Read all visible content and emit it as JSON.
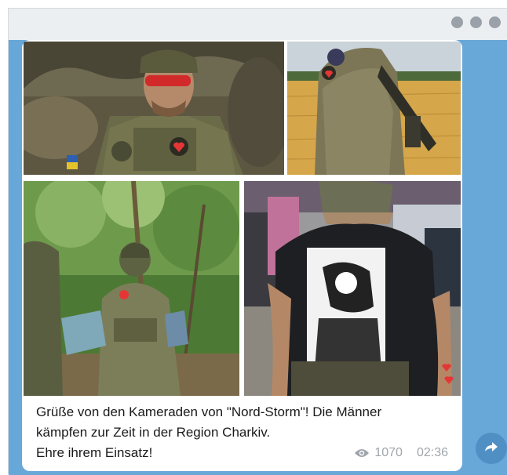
{
  "window": {
    "controls": [
      "window-dot-icon",
      "window-dot-icon",
      "window-dot-icon"
    ]
  },
  "message": {
    "caption_lines": [
      "Grüße von den Kameraden von \"Nord-Storm\"! Die Männer",
      "kämpfen zur Zeit in der Region Charkiv.",
      "Ehre ihrem Einsatz!"
    ],
    "views": "1070",
    "time": "02:36",
    "icons": {
      "views": "eye-icon",
      "share": "share-arrow-icon"
    }
  },
  "colors": {
    "chat_background": "#68a8d8",
    "share_button": "#4f8fc4",
    "meta_text": "#a0a6ac"
  }
}
